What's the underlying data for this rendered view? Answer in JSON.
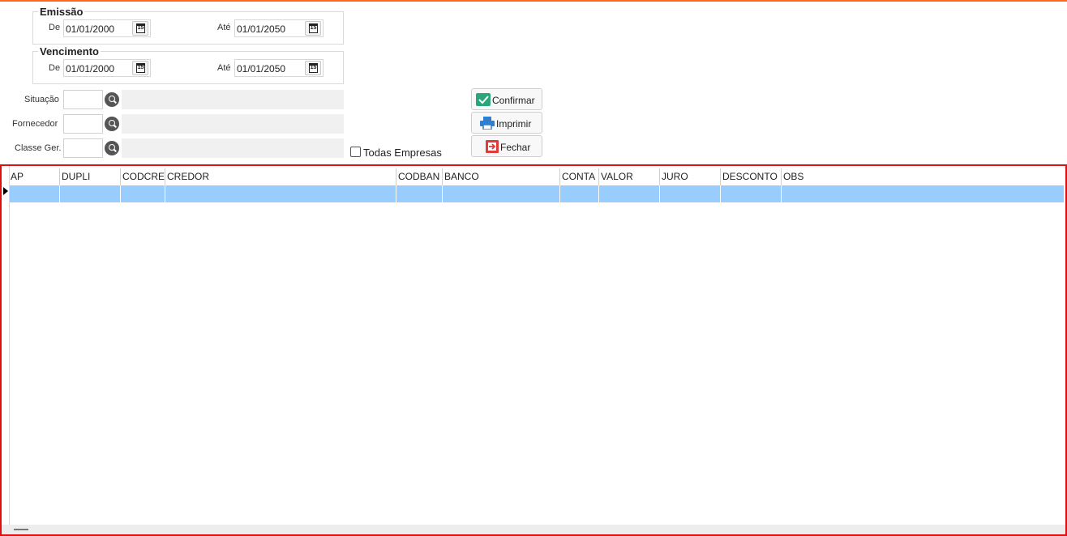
{
  "emissao": {
    "legend": "Emissão",
    "de_label": "De",
    "de_value": "01/01/2000",
    "ate_label": "Até",
    "ate_value": "01/01/2050"
  },
  "vencimento": {
    "legend": "Vencimento",
    "de_label": "De",
    "de_value": "01/01/2000",
    "ate_label": "Até",
    "ate_value": "01/01/2050"
  },
  "filters": {
    "situacao_label": "Situação",
    "situacao_value": "",
    "fornecedor_label": "Fornecedor",
    "fornecedor_value": "",
    "classe_label": "Classe Ger.",
    "classe_value": ""
  },
  "todas_empresas": {
    "label": "Todas Empresas",
    "checked": false
  },
  "buttons": {
    "confirmar": "Confirmar",
    "imprimir": "Imprimir",
    "fechar": "Fechar"
  },
  "calendar_icon_text": "15",
  "grid": {
    "columns": [
      "AP",
      "DUPLI",
      "CODCRE",
      "CREDOR",
      "CODBAN",
      "BANCO",
      "CONTA",
      "VALOR",
      "JURO",
      "DESCONTO",
      "OBS"
    ]
  },
  "colors": {
    "accent_top": "#ff6a1a",
    "grid_border": "#e01010",
    "selected_row": "#99ccff"
  }
}
